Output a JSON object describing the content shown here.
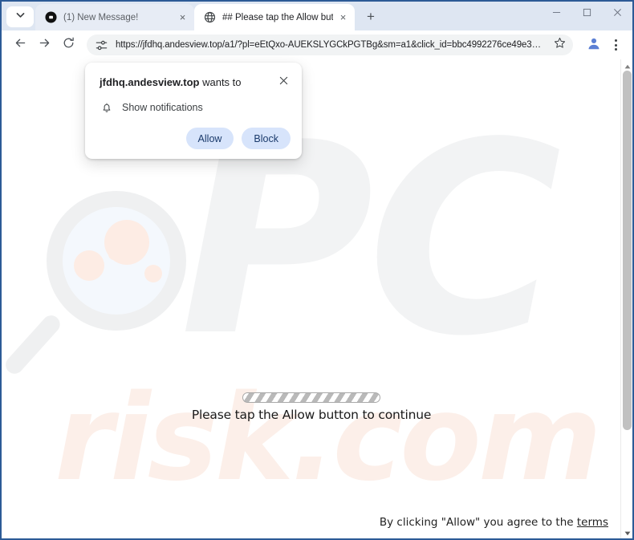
{
  "window": {
    "controls": [
      {
        "name": "minimize",
        "glyph": "minimize-icon"
      },
      {
        "name": "maximize",
        "glyph": "maximize-icon"
      },
      {
        "name": "close",
        "glyph": "close-icon"
      }
    ]
  },
  "tabstrip": {
    "tab_search_icon": "chevron-down-icon",
    "new_tab_label": "+",
    "tabs": [
      {
        "title": "(1) New Message!",
        "favicon": "dark-circle-play-icon",
        "active": false,
        "close_label": "×"
      },
      {
        "title": "## Please tap the Allow button",
        "favicon": "globe-icon",
        "active": true,
        "close_label": "×"
      }
    ]
  },
  "toolbar": {
    "back_icon": "arrow-left-icon",
    "forward_icon": "arrow-right-icon",
    "reload_icon": "reload-icon",
    "site_info_icon": "tune-settings-icon",
    "url": "https://jfdhq.andesview.top/a1/?pl=eEtQxo-AUEKSLYGCkPGTBg&sm=a1&click_id=bbc4992276ce49e3…",
    "bookmark_icon": "star-icon",
    "profile_icon": "avatar-icon",
    "menu_icon": "three-dots-icon"
  },
  "permission_dialog": {
    "origin": "jfdhq.andesview.top",
    "title_suffix": " wants to",
    "close_label": "✕",
    "permission_icon": "bell-icon",
    "permission_label": "Show notifications",
    "allow_label": "Allow",
    "block_label": "Block",
    "button_bg": "#d7e4fb",
    "button_text_color": "#1a3a6b"
  },
  "page": {
    "watermark_pc": "PC",
    "watermark_risk": "risk.com",
    "progress_label": "loading-progress-bar",
    "message": "Please tap the Allow button to continue",
    "footer_prefix": "By clicking \"Allow\" you agree to the ",
    "footer_link": "terms"
  },
  "scrollbar": {
    "up_icon": "scroll-up-arrow-icon",
    "down_icon": "scroll-down-arrow-icon"
  }
}
